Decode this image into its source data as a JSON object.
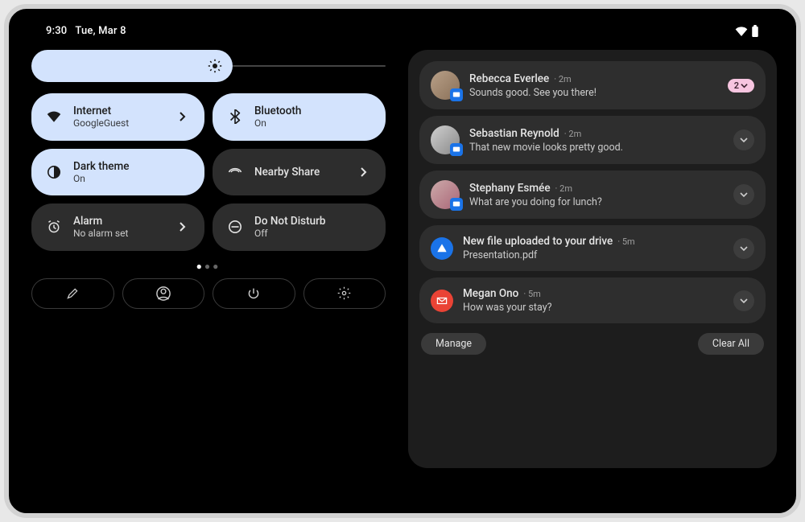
{
  "statusbar": {
    "time": "9:30",
    "date": "Tue, Mar 8"
  },
  "tiles": [
    {
      "title": "Internet",
      "sub": "GoogleGuest",
      "active": true,
      "icon": "wifi",
      "arrow": true
    },
    {
      "title": "Bluetooth",
      "sub": "On",
      "active": true,
      "icon": "bluetooth",
      "arrow": false
    },
    {
      "title": "Dark theme",
      "sub": "On",
      "active": true,
      "icon": "dark",
      "arrow": false
    },
    {
      "title": "Nearby Share",
      "sub": "",
      "active": false,
      "icon": "nearby",
      "arrow": true
    },
    {
      "title": "Alarm",
      "sub": "No alarm set",
      "active": false,
      "icon": "alarm",
      "arrow": true
    },
    {
      "title": "Do Not Disturb",
      "sub": "Off",
      "active": false,
      "icon": "dnd",
      "arrow": false
    }
  ],
  "notifications": [
    {
      "name": "Rebecca Everlee",
      "time": "2m",
      "msg": "Sounds good. See you there!",
      "badge_count": "2",
      "avatar": true,
      "app_badge": "messages"
    },
    {
      "name": "Sebastian Reynold",
      "time": "2m",
      "msg": "That new movie looks pretty good.",
      "avatar": true,
      "app_badge": "messages",
      "expand": true
    },
    {
      "name": "Stephany Esmée",
      "time": "2m",
      "msg": "What are you doing for lunch?",
      "avatar": true,
      "app_badge": "messages",
      "expand": true
    },
    {
      "name": "New file uploaded to your drive",
      "time": "5m",
      "msg": "Presentation.pdf",
      "icon_color": "#1a73e8",
      "icon": "drive",
      "expand": true
    },
    {
      "name": "Megan Ono",
      "time": "5m",
      "msg": "How was your stay?",
      "icon_color": "#ea4335",
      "icon": "gmail",
      "expand": true
    }
  ],
  "notif_actions": {
    "manage": "Manage",
    "clear": "Clear All"
  }
}
